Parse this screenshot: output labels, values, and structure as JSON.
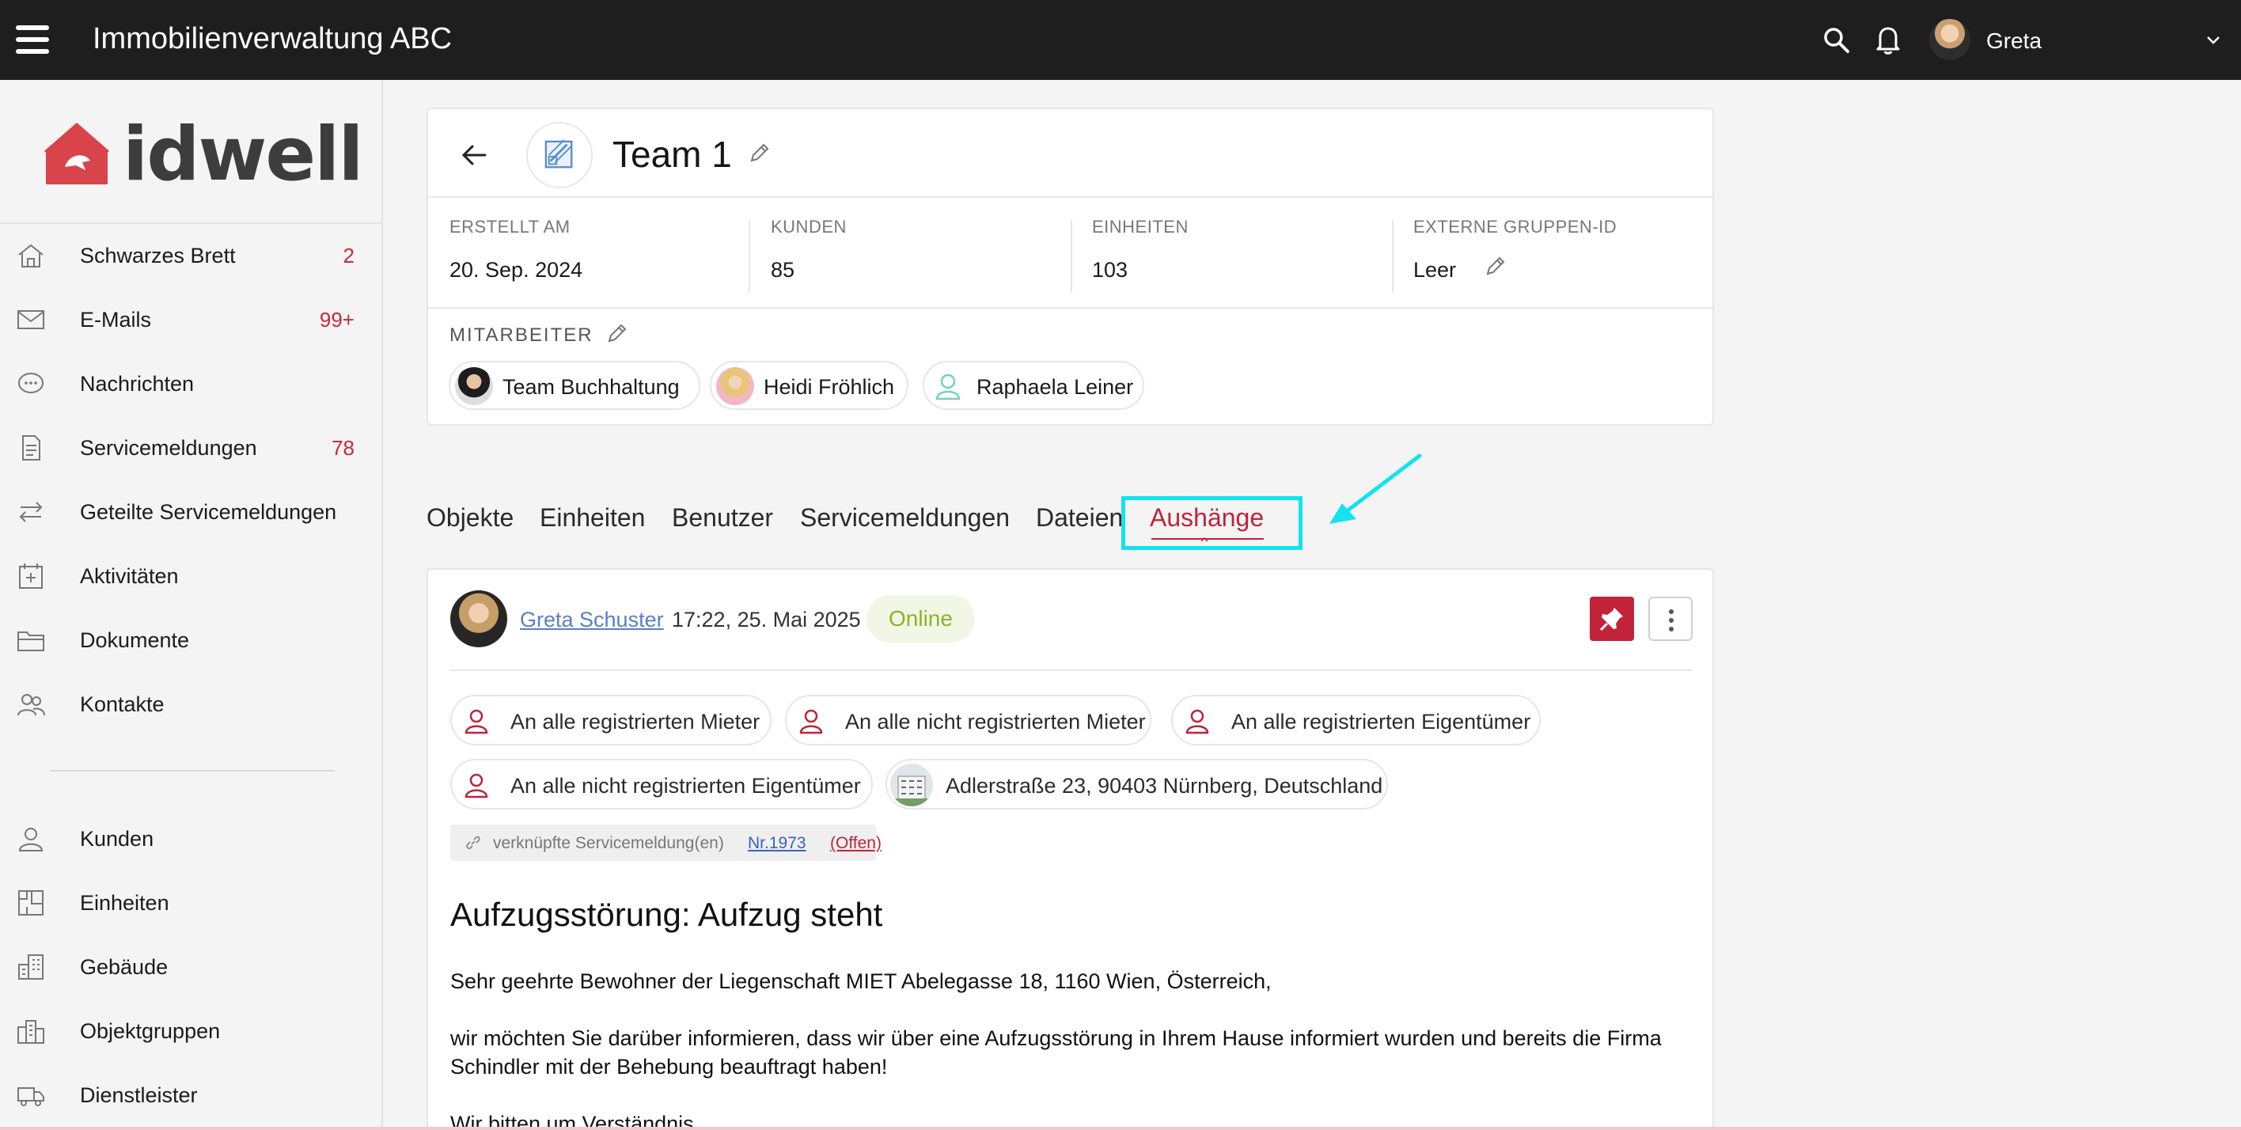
{
  "topbar": {
    "title": "Immobilienverwaltung ABC",
    "user_name": "Greta"
  },
  "sidebar": {
    "logo_text": "idwell",
    "items": [
      {
        "label": "Schwarzes Brett",
        "count": "2",
        "icon": "home-icon"
      },
      {
        "label": "E-Mails",
        "count": "99+",
        "icon": "mail-icon"
      },
      {
        "label": "Nachrichten",
        "count": "",
        "icon": "chat-icon"
      },
      {
        "label": "Servicemeldungen",
        "count": "78",
        "icon": "document-icon"
      },
      {
        "label": "Geteilte Servicemeldungen",
        "count": "",
        "icon": "swap-icon"
      },
      {
        "label": "Aktivitäten",
        "count": "",
        "icon": "calendar-icon"
      },
      {
        "label": "Dokumente",
        "count": "",
        "icon": "folder-icon"
      },
      {
        "label": "Kontakte",
        "count": "",
        "icon": "contacts-icon"
      },
      {
        "label": "Kunden",
        "count": "",
        "icon": "person-icon"
      },
      {
        "label": "Einheiten",
        "count": "",
        "icon": "floorplan-icon"
      },
      {
        "label": "Gebäude",
        "count": "",
        "icon": "building-icon"
      },
      {
        "label": "Objektgruppen",
        "count": "",
        "icon": "buildings-icon"
      },
      {
        "label": "Dienstleister",
        "count": "",
        "icon": "truck-icon"
      }
    ]
  },
  "group": {
    "title": "Team 1",
    "stats": [
      {
        "label": "ERSTELLT AM",
        "value": "20. Sep. 2024"
      },
      {
        "label": "KUNDEN",
        "value": "85"
      },
      {
        "label": "EINHEITEN",
        "value": "103"
      },
      {
        "label": "EXTERNE GRUPPEN-ID",
        "value": "Leer"
      }
    ],
    "mitarbeiter_label": "MITARBEITER",
    "mitarbeiter": [
      "Team Buchhaltung",
      "Heidi Fröhlich",
      "Raphaela Leiner"
    ]
  },
  "tabs": [
    {
      "label": "Objekte",
      "active": false
    },
    {
      "label": "Einheiten",
      "active": false
    },
    {
      "label": "Benutzer",
      "active": false
    },
    {
      "label": "Servicemeldungen",
      "active": false
    },
    {
      "label": "Dateien",
      "active": false
    },
    {
      "label": "Aushänge",
      "active": true
    }
  ],
  "post": {
    "author": "Greta Schuster",
    "time": "17:22, 25. Mai 2025",
    "status": "Online",
    "recipients": [
      "An alle registrierten Mieter",
      "An alle nicht registrierten Mieter",
      "An alle registrierten Eigentümer",
      "An alle nicht registrierten Eigentümer"
    ],
    "address": "Adlerstraße 23, 90403 Nürnberg, Deutschland",
    "linked_label": "verknüpfte Servicemeldung(en)",
    "linked_number": "Nr.1973",
    "linked_status": "(Offen)",
    "title": "Aufzugsstörung: Aufzug steht",
    "paragraphs": [
      "Sehr geehrte Bewohner der Liegenschaft MIET Abelegasse 18, 1160 Wien, Österreich,",
      "wir möchten Sie darüber informieren, dass wir über eine Aufzugsstörung in Ihrem Hause informiert wurden und bereits die Firma Schindler mit der Behebung beauftragt haben!",
      "Wir bitten um Verständnis."
    ]
  },
  "colors": {
    "accent": "#c0233a",
    "topbar": "#1e1e1e",
    "highlight": "#14e2f0",
    "online": "#8ab32a"
  }
}
